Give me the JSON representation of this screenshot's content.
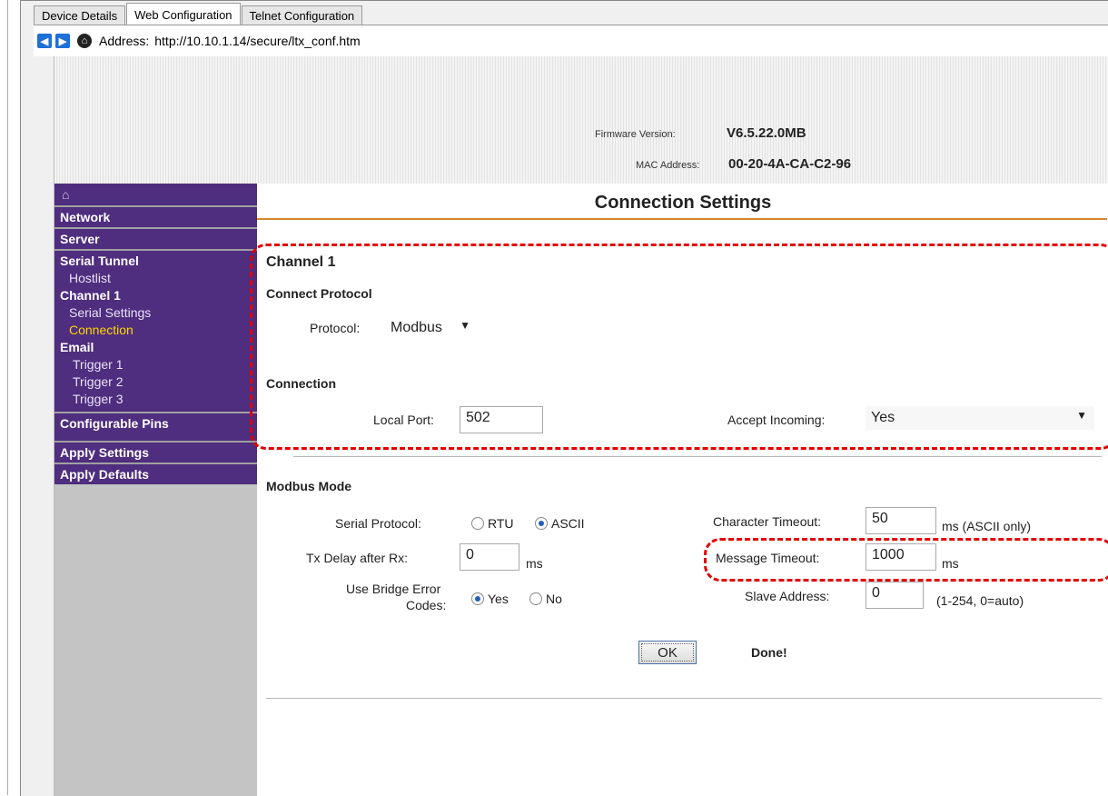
{
  "tabs": [
    {
      "label": "Device Details"
    },
    {
      "label": "Web Configuration"
    },
    {
      "label": "Telnet Configuration"
    }
  ],
  "address": {
    "label": "Address:",
    "value": "http://10.10.1.14/secure/ltx_conf.htm"
  },
  "header": {
    "firmware_label": "Firmware Version:",
    "firmware_value": "V6.5.22.0MB",
    "mac_label": "MAC Address:",
    "mac_value": "00-20-4A-CA-C2-96"
  },
  "sidebar": {
    "network": "Network",
    "server": "Server",
    "serial_tunnel": "Serial Tunnel",
    "hostlist": "Hostlist",
    "channel1": "Channel 1",
    "serial_settings": "Serial Settings",
    "connection": "Connection",
    "email": "Email",
    "trigger1": "Trigger 1",
    "trigger2": "Trigger 2",
    "trigger3": "Trigger 3",
    "configurable_pins": "Configurable Pins",
    "apply_settings": "Apply Settings",
    "apply_defaults": "Apply Defaults"
  },
  "main": {
    "title": "Connection Settings",
    "channel": "Channel 1",
    "connect_protocol": "Connect Protocol",
    "protocol_label": "Protocol:",
    "protocol_value": "Modbus",
    "connection": "Connection",
    "local_port_label": "Local Port:",
    "local_port_value": "502",
    "accept_incoming_label": "Accept Incoming:",
    "accept_incoming_value": "Yes",
    "modbus_mode": "Modbus Mode",
    "serial_protocol_label": "Serial Protocol:",
    "rtu": "RTU",
    "ascii": "ASCII",
    "tx_delay_label": "Tx Delay after Rx:",
    "tx_delay_value": "0",
    "tx_delay_unit": "ms",
    "bridge_label_1": "Use Bridge Error",
    "bridge_label_2": "Codes:",
    "yes": "Yes",
    "no": "No",
    "char_timeout_label": "Character Timeout:",
    "char_timeout_value": "50",
    "char_timeout_unit": "ms (ASCII only)",
    "msg_timeout_label": "Message Timeout:",
    "msg_timeout_value": "1000",
    "msg_timeout_unit": "ms",
    "slave_label": "Slave Address:",
    "slave_value": "0",
    "slave_hint": "(1-254, 0=auto)",
    "ok": "OK",
    "status": "Done!"
  },
  "colors": {
    "sidebar": "#4f2d7f",
    "active_item": "#ffd700",
    "title_rule": "#d7882a",
    "highlight": "#e10000"
  }
}
